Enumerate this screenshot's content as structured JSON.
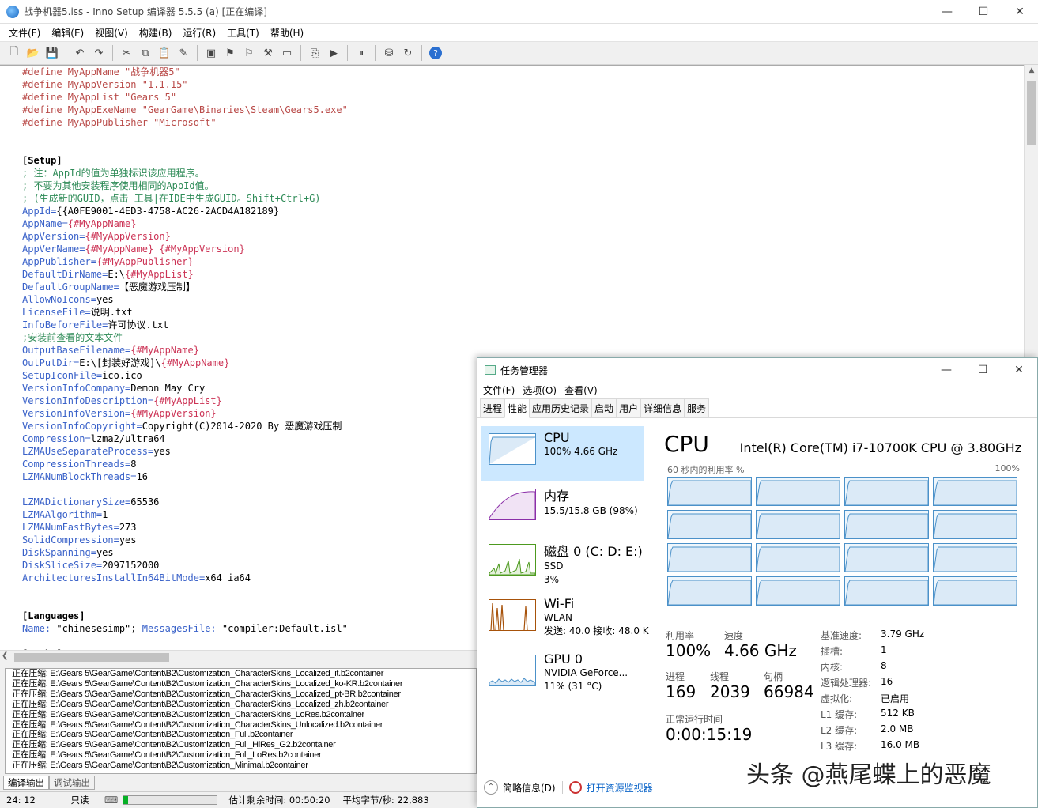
{
  "inno": {
    "title": "战争机器5.iss - Inno Setup 编译器 5.5.5 (a)  [正在编译]",
    "menu": [
      "文件(F)",
      "编辑(E)",
      "视图(V)",
      "构建(B)",
      "运行(R)",
      "工具(T)",
      "帮助(H)"
    ],
    "toolbar_icons": [
      "new-icon",
      "open-icon",
      "save-icon",
      "undo-icon",
      "redo-icon",
      "cut-icon",
      "copy-icon",
      "paste-icon",
      "find-icon",
      "replace-icon",
      "compile-icon",
      "stop-compile-icon",
      "compile-wizard-icon",
      "go-icon",
      "step-icon",
      "run-icon",
      "pause-icon",
      "script-icon",
      "target-icon",
      "help-icon"
    ],
    "code": [
      {
        "t": "def",
        "text": "#define MyAppName \"战争机器5\""
      },
      {
        "t": "def",
        "text": "#define MyAppVersion \"1.1.15\""
      },
      {
        "t": "def",
        "text": "#define MyAppList \"Gears 5\""
      },
      {
        "t": "def",
        "text": "#define MyAppExeName \"GearGame\\Binaries\\Steam\\Gears5.exe\""
      },
      {
        "t": "def",
        "text": "#define MyAppPublisher \"Microsoft\""
      },
      {
        "t": "blank",
        "text": ""
      },
      {
        "t": "blank",
        "text": ""
      },
      {
        "t": "sec",
        "text": "[Setup]"
      },
      {
        "t": "cmt",
        "text": "; 注：AppId的值为单独标识该应用程序。"
      },
      {
        "t": "cmt",
        "text": "; 不要为其他安装程序使用相同的AppId值。"
      },
      {
        "t": "cmt",
        "text": "; (生成新的GUID，点击 工具|在IDE中生成GUID。Shift+Ctrl+G)"
      },
      {
        "t": "kv",
        "key": "AppId",
        "val": "{{A0FE9001-4ED3-4758-AC26-2ACD4A182189}"
      },
      {
        "t": "kv",
        "key": "AppName",
        "con": "{#MyAppName}"
      },
      {
        "t": "kv",
        "key": "AppVersion",
        "con": "{#MyAppVersion}"
      },
      {
        "t": "kv",
        "key": "AppVerName",
        "con": "{#MyAppName} {#MyAppVersion}"
      },
      {
        "t": "kv",
        "key": "AppPublisher",
        "con": "{#MyAppPublisher}"
      },
      {
        "t": "kv",
        "key": "DefaultDirName",
        "val": "E:\\",
        "con": "{#MyAppList}"
      },
      {
        "t": "kv",
        "key": "DefaultGroupName",
        "val": "【恶魔游戏压制】"
      },
      {
        "t": "kv",
        "key": "AllowNoIcons",
        "val": "yes"
      },
      {
        "t": "kv",
        "key": "LicenseFile",
        "val": "说明.txt"
      },
      {
        "t": "kv",
        "key": "InfoBeforeFile",
        "val": "许可协议.txt"
      },
      {
        "t": "cmt",
        "text": ";安装前查看的文本文件"
      },
      {
        "t": "kv",
        "key": "OutputBaseFilename",
        "con": "{#MyAppName}"
      },
      {
        "t": "kv",
        "key": "OutPutDir",
        "val": "E:\\[封装好游戏]\\",
        "con": "{#MyAppName}"
      },
      {
        "t": "kv",
        "key": "SetupIconFile",
        "val": "ico.ico"
      },
      {
        "t": "kv",
        "key": "VersionInfoCompany",
        "val": "Demon May Cry"
      },
      {
        "t": "kv",
        "key": "VersionInfoDescription",
        "con": "{#MyAppList}"
      },
      {
        "t": "kv",
        "key": "VersionInfoVersion",
        "con": "{#MyAppVersion}"
      },
      {
        "t": "kv",
        "key": "VersionInfoCopyright",
        "val": "Copyright(C)2014-2020 By 恶魔游戏压制"
      },
      {
        "t": "kv",
        "key": "Compression",
        "val": "lzma2/ultra64"
      },
      {
        "t": "kv",
        "key": "LZMAUseSeparateProcess",
        "val": "yes"
      },
      {
        "t": "kv",
        "key": "CompressionThreads",
        "val": "8"
      },
      {
        "t": "kv",
        "key": "LZMANumBlockThreads",
        "val": "16"
      },
      {
        "t": "blank",
        "text": ""
      },
      {
        "t": "kv",
        "key": "LZMADictionarySize",
        "val": "65536"
      },
      {
        "t": "kv",
        "key": "LZMAAlgorithm",
        "val": "1"
      },
      {
        "t": "kv",
        "key": "LZMANumFastBytes",
        "val": "273"
      },
      {
        "t": "kv",
        "key": "SolidCompression",
        "val": "yes"
      },
      {
        "t": "kv",
        "key": "DiskSpanning",
        "val": "yes"
      },
      {
        "t": "kv",
        "key": "DiskSliceSize",
        "val": "2097152000"
      },
      {
        "t": "kv",
        "key": "ArchitecturesInstallIn64BitMode",
        "val": "x64 ia64"
      },
      {
        "t": "blank",
        "text": ""
      },
      {
        "t": "blank",
        "text": ""
      },
      {
        "t": "sec",
        "text": "[Languages]"
      },
      {
        "t": "lang",
        "k1": "Name:",
        "v1": " \"chinesesimp\"; ",
        "k2": "MessagesFile:",
        "v2": " \"compiler:Default.isl\""
      },
      {
        "t": "blank",
        "text": ""
      },
      {
        "t": "sec",
        "text": "[Tasks]"
      }
    ],
    "output_lines": [
      "正在压缩: E:\\Gears 5\\GearGame\\Content\\B2\\Customization_CharacterSkins_Localized_it.b2container",
      "正在压缩: E:\\Gears 5\\GearGame\\Content\\B2\\Customization_CharacterSkins_Localized_ko-KR.b2container",
      "正在压缩: E:\\Gears 5\\GearGame\\Content\\B2\\Customization_CharacterSkins_Localized_pt-BR.b2container",
      "正在压缩: E:\\Gears 5\\GearGame\\Content\\B2\\Customization_CharacterSkins_Localized_zh.b2container",
      "正在压缩: E:\\Gears 5\\GearGame\\Content\\B2\\Customization_CharacterSkins_LoRes.b2container",
      "正在压缩: E:\\Gears 5\\GearGame\\Content\\B2\\Customization_CharacterSkins_Unlocalized.b2container",
      "正在压缩: E:\\Gears 5\\GearGame\\Content\\B2\\Customization_Full.b2container",
      "正在压缩: E:\\Gears 5\\GearGame\\Content\\B2\\Customization_Full_HiRes_G2.b2container",
      "正在压缩: E:\\Gears 5\\GearGame\\Content\\B2\\Customization_Full_LoRes.b2container",
      "正在压缩: E:\\Gears 5\\GearGame\\Content\\B2\\Customization_Minimal.b2container"
    ],
    "output_tabs": {
      "compile": "编译输出",
      "debug": "调试输出"
    },
    "status": {
      "position": "24:  12",
      "readonly": "只读",
      "progress": 0.05,
      "remaining": "估计剩余时间: 00:50:20",
      "speed": "平均字节/秒: 22,883"
    }
  },
  "tm": {
    "title": "任务管理器",
    "menu": [
      "文件(F)",
      "选项(O)",
      "查看(V)"
    ],
    "tabs": [
      "进程",
      "性能",
      "应用历史记录",
      "启动",
      "用户",
      "详细信息",
      "服务"
    ],
    "side": {
      "cpu": {
        "name": "CPU",
        "sub": "100%  4.66 GHz"
      },
      "mem": {
        "name": "内存",
        "sub": "15.5/15.8 GB (98%)"
      },
      "disk": {
        "name": "磁盘 0 (C: D: E:)",
        "sub1": "SSD",
        "sub2": "3%"
      },
      "wifi": {
        "name": "Wi-Fi",
        "sub1": "WLAN",
        "sub2": "发送: 40.0  接收: 48.0 K"
      },
      "gpu": {
        "name": "GPU 0",
        "sub1": "NVIDIA GeForce...",
        "sub2": "11% (31 °C)"
      }
    },
    "main": {
      "title": "CPU",
      "cpu_model": "Intel(R) Core(TM) i7-10700K CPU @ 3.80GHz",
      "graph_label": "60 秒内的利用率 %",
      "graph_max": "100%",
      "util_label": "利用率",
      "util": "100%",
      "speed_label": "速度",
      "speed": "4.66 GHz",
      "proc_label": "进程",
      "proc": "169",
      "thread_label": "线程",
      "thread": "2039",
      "handle_label": "句柄",
      "handle": "66984",
      "uptime_label": "正常运行时间",
      "uptime": "0:00:15:19",
      "specs": [
        {
          "k": "基准速度:",
          "v": "3.79 GHz"
        },
        {
          "k": "插槽:",
          "v": "1"
        },
        {
          "k": "内核:",
          "v": "8"
        },
        {
          "k": "逻辑处理器:",
          "v": "16"
        },
        {
          "k": "虚拟化:",
          "v": "已启用"
        },
        {
          "k": "L1 缓存:",
          "v": "512 KB"
        },
        {
          "k": "L2 缓存:",
          "v": "2.0 MB"
        },
        {
          "k": "L3 缓存:",
          "v": "16.0 MB"
        }
      ]
    },
    "footer": {
      "less": "简略信息(D)",
      "monitor": "打开资源监视器"
    }
  },
  "watermark": "头条 @燕尾蝶上的恶魔",
  "colors": {
    "cpu": "#4b91c9",
    "mem": "#8b2fa8",
    "disk": "#4d9a1f",
    "wifi": "#a7520a",
    "gpu": "#4b91c9"
  }
}
